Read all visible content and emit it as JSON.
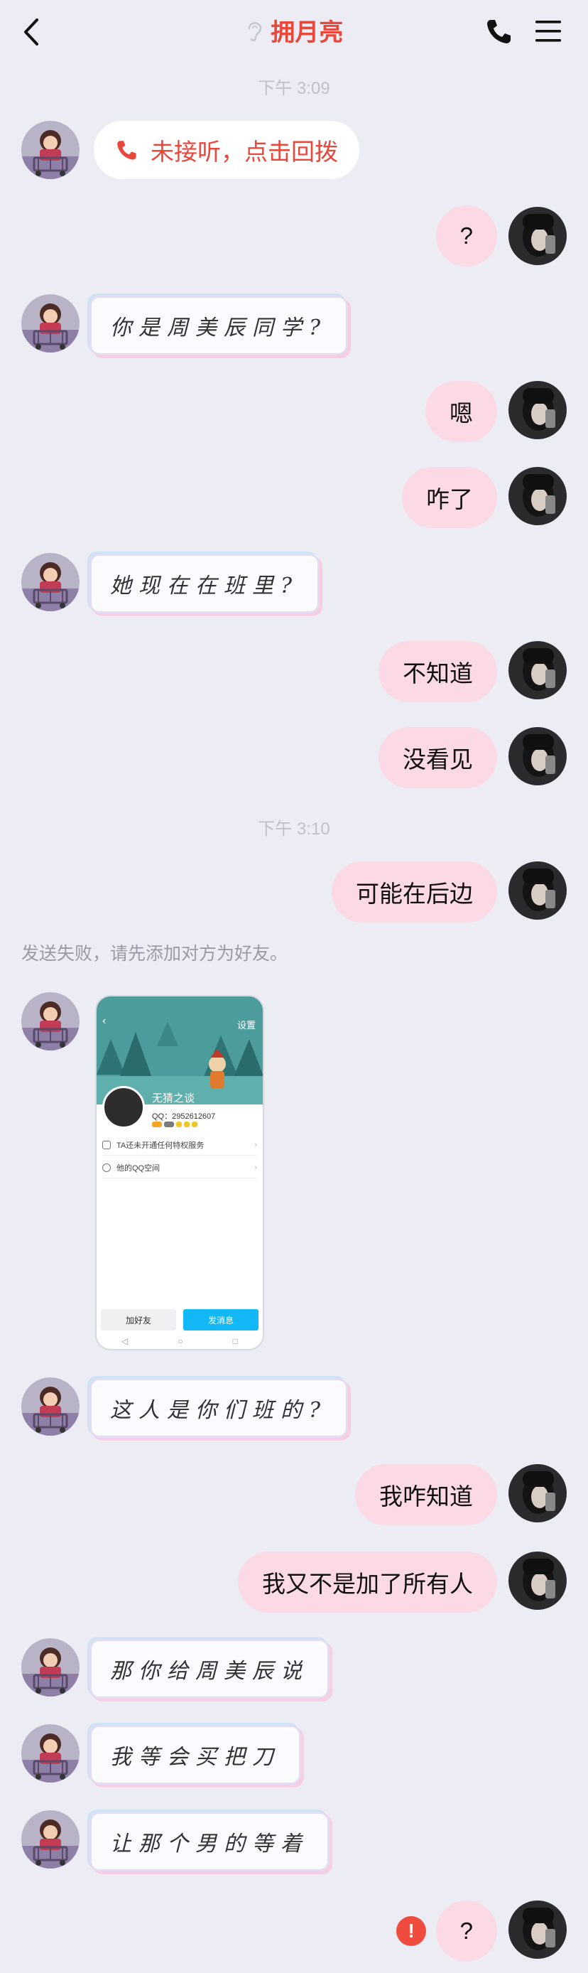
{
  "header": {
    "title": "拥月亮"
  },
  "times": [
    "下午 3:09",
    "下午 3:10"
  ],
  "notice": "发送失败，请先添加对方为好友。",
  "messages": {
    "m1": "未接听，点击回拨",
    "m2": "?",
    "m3": "你是周美辰同学?",
    "m4": "嗯",
    "m5": "咋了",
    "m6": "她现在在班里?",
    "m7": "不知道",
    "m8": "没看见",
    "m9": "可能在后边",
    "m10": "这人是你们班的?",
    "m11": "我咋知道",
    "m12": "我又不是加了所有人",
    "m13": "那你给周美辰说",
    "m14": "我等会买把刀",
    "m15": "让那个男的等着",
    "m16": "?"
  },
  "shared_screenshot": {
    "settings": "设置",
    "name": "无猜之谈",
    "qq": "QQ：2952612607",
    "row1": "TA还未开通任何特权服务",
    "row2": "他的QQ空间",
    "btn_add": "加好友",
    "btn_msg": "发消息",
    "nav": [
      "◁",
      "○",
      "□"
    ]
  },
  "fail_mark": "!",
  "colors": {
    "accent": "#e8473b",
    "bubble_right": "#fbd9e5",
    "background": "#ececf5"
  }
}
